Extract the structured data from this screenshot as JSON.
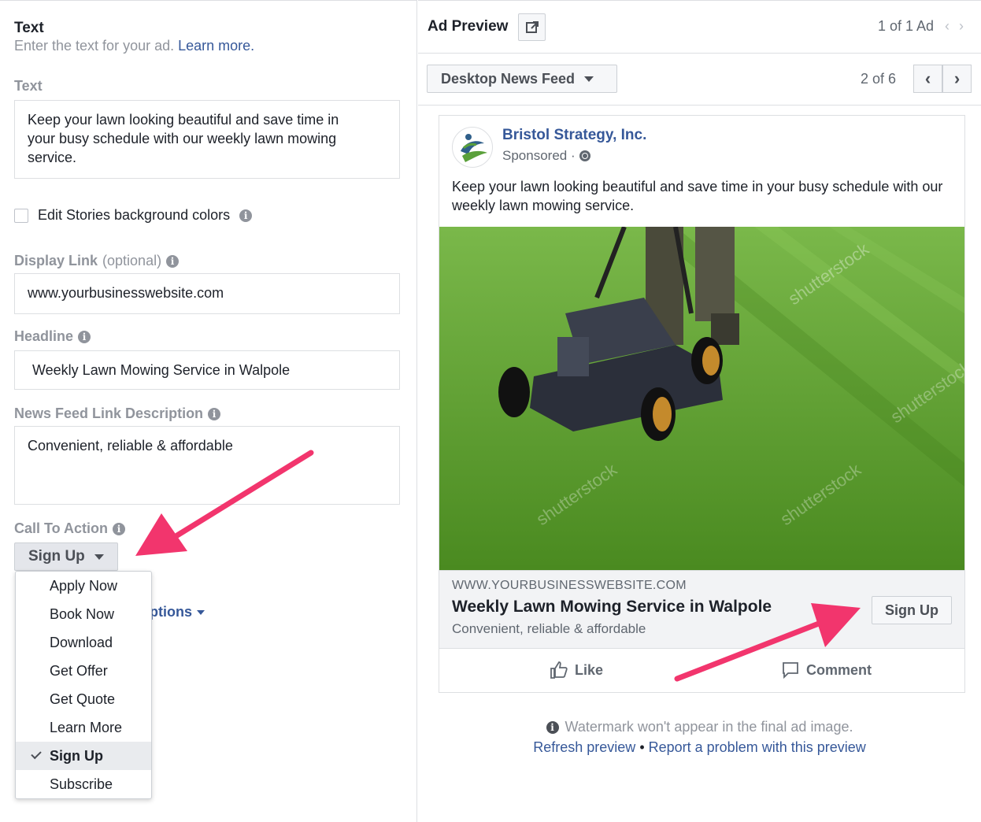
{
  "text_section": {
    "title": "Text",
    "subtitle": "Enter the text for your ad.",
    "learn_more": "Learn more."
  },
  "fields": {
    "text_label": "Text",
    "text_value": "Keep your lawn looking beautiful and save time in your busy schedule with our weekly lawn mowing service.",
    "stories_bg_label": "Edit Stories background colors",
    "display_link_label": "Display Link",
    "display_link_optional": "(optional)",
    "display_link_value": "www.yourbusinesswebsite.com",
    "headline_label": "Headline",
    "headline_value": "Weekly Lawn Mowing Service in Walpole",
    "link_desc_label": "News Feed Link Description",
    "link_desc_value": "Convenient, reliable & affordable",
    "cta_label": "Call To Action",
    "cta_value": "Sign Up",
    "more_options_visible": "ptions"
  },
  "cta_options": [
    "Apply Now",
    "Book Now",
    "Download",
    "Get Offer",
    "Get Quote",
    "Learn More",
    "Sign Up",
    "Subscribe"
  ],
  "cta_selected_index": 6,
  "preview": {
    "title": "Ad Preview",
    "ad_count": "1 of 1 Ad",
    "placement": "Desktop News Feed",
    "placement_count": "2 of 6",
    "page_name": "Bristol Strategy, Inc.",
    "sponsored": "Sponsored ·",
    "post_text": "Keep your lawn looking beautiful and save time in your busy schedule with our weekly lawn mowing service.",
    "domain": "WWW.YOURBUSINESSWEBSITE.COM",
    "headline": "Weekly Lawn Mowing Service in Walpole",
    "description": "Convenient, reliable & affordable",
    "cta_button": "Sign Up",
    "like": "Like",
    "comment": "Comment",
    "watermark_note": "Watermark won't appear in the final ad image.",
    "refresh": "Refresh preview",
    "separator": " • ",
    "report": "Report a problem with this preview"
  },
  "colors": {
    "link_blue": "#365899",
    "arrow_pink": "#f2356d",
    "grass_green": "#5c9a2c"
  }
}
